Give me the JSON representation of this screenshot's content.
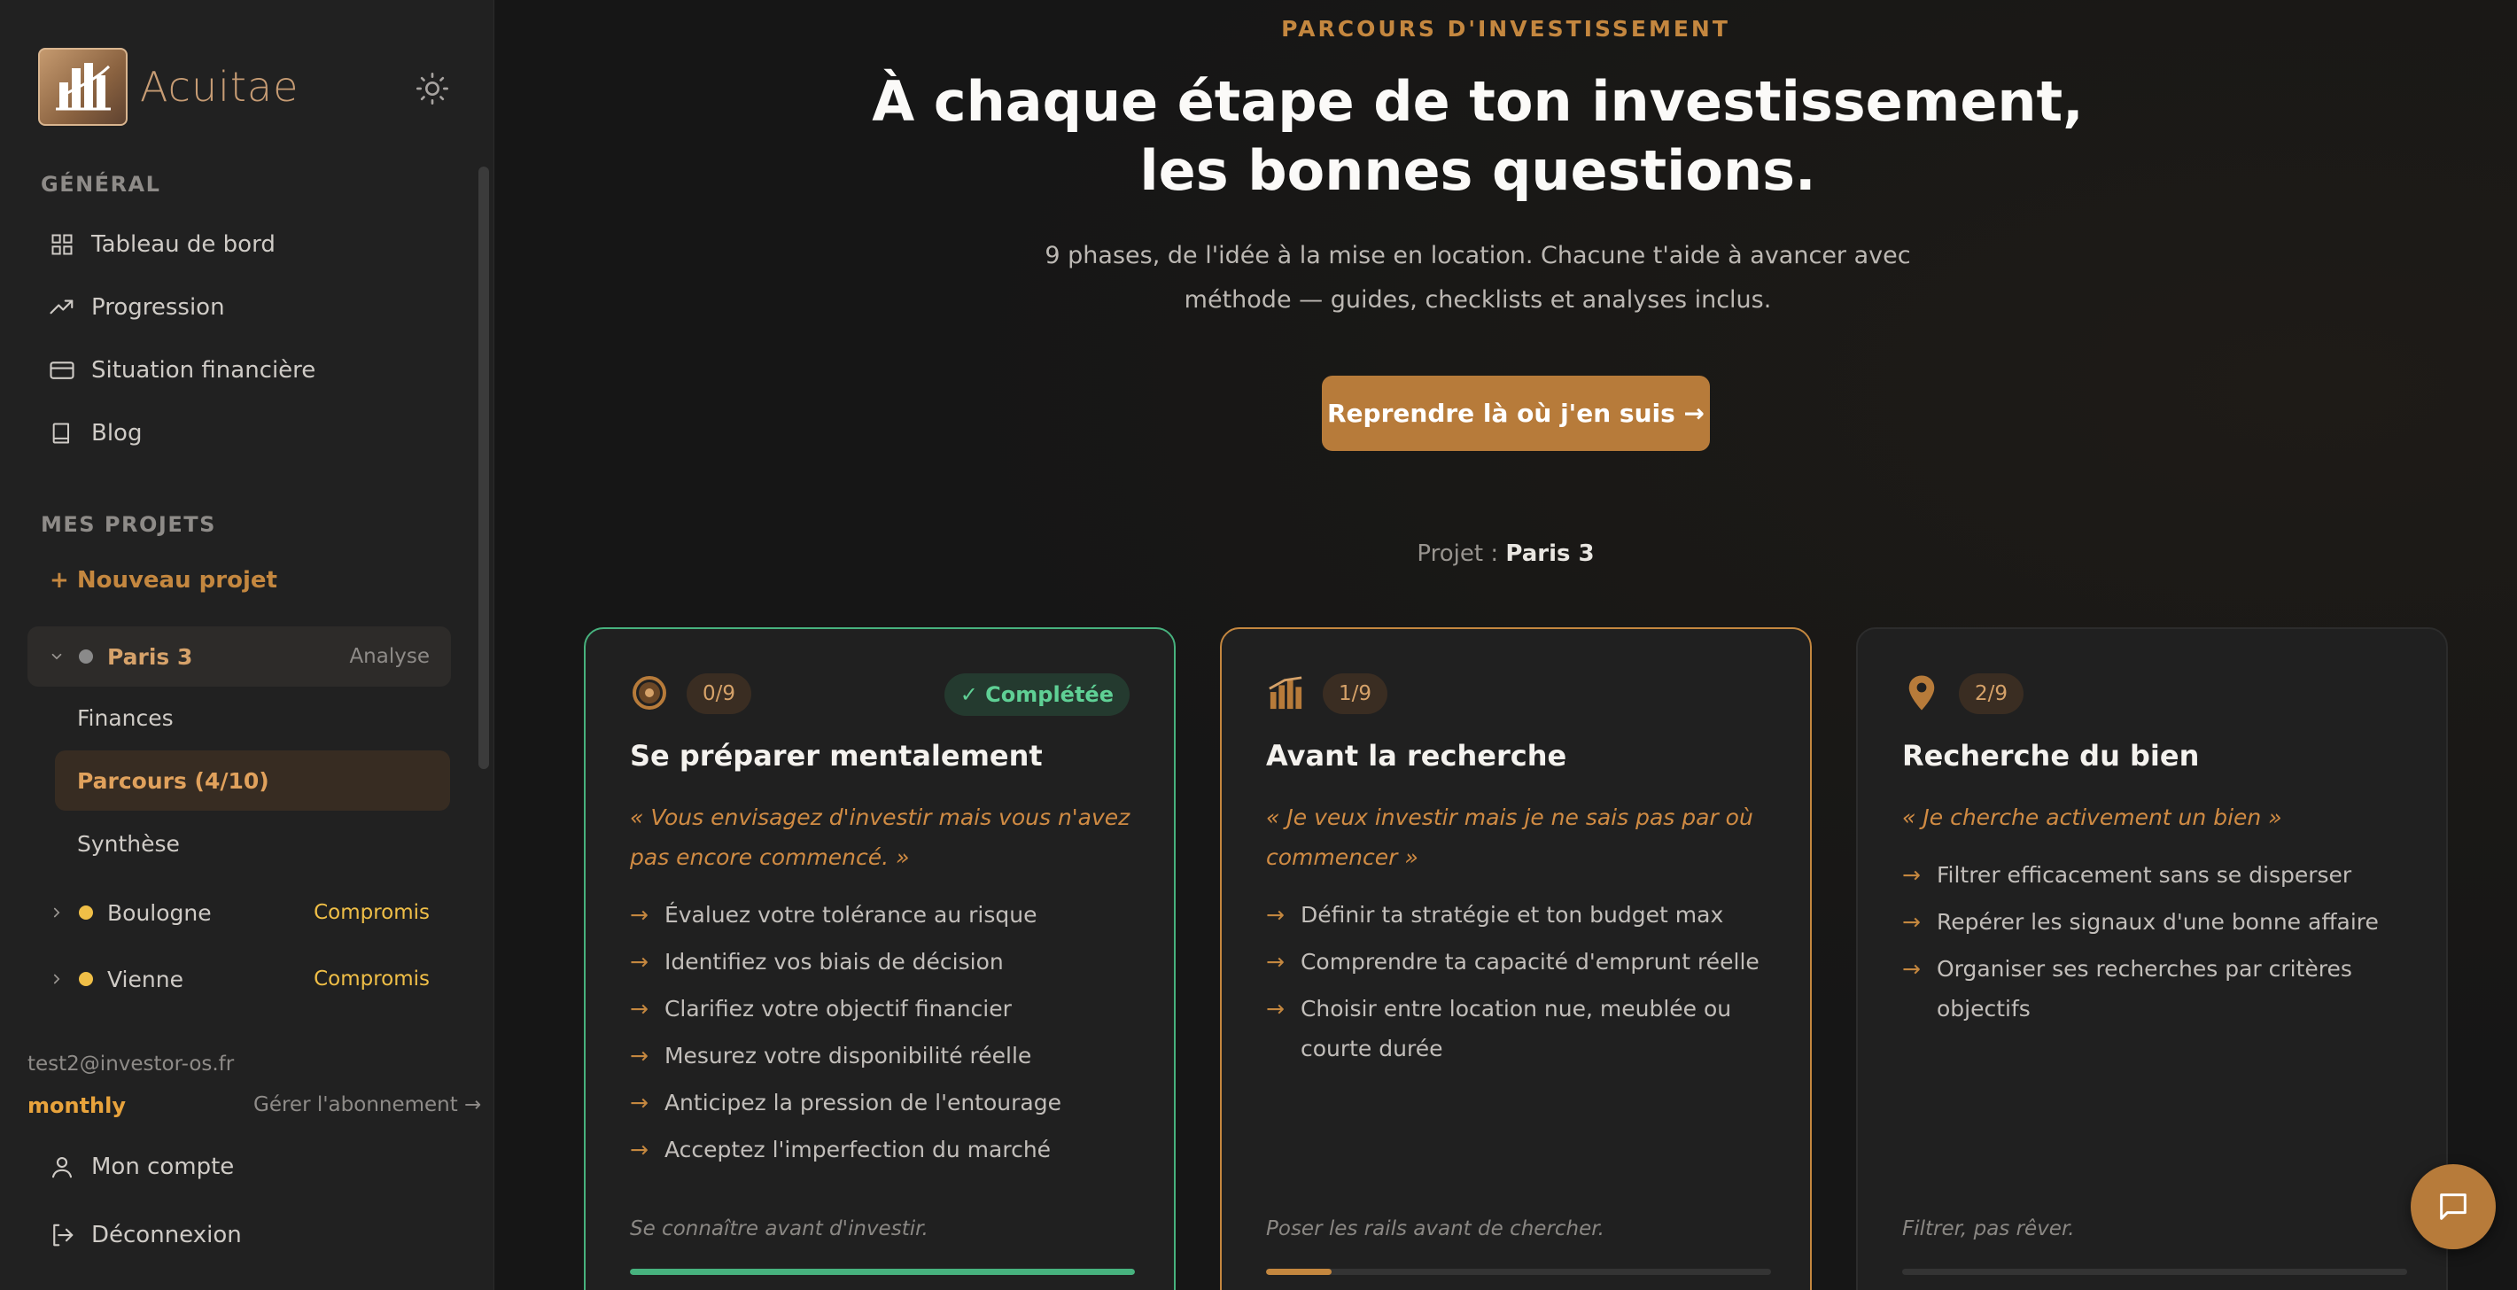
{
  "brand": {
    "name": "Acuitae"
  },
  "sidebar": {
    "general_label": "GÉNÉRAL",
    "nav": [
      {
        "label": "Tableau de bord",
        "icon": "grid-icon"
      },
      {
        "label": "Progression",
        "icon": "trending-up-icon"
      },
      {
        "label": "Situation financière",
        "icon": "credit-card-icon"
      },
      {
        "label": "Blog",
        "icon": "book-icon"
      }
    ],
    "projects_label": "MES PROJETS",
    "new_project": "+ Nouveau projet",
    "projects": [
      {
        "name": "Paris 3",
        "status": "Analyse",
        "expanded": true,
        "dot_color": "#8a8a8a"
      },
      {
        "name": "Boulogne",
        "status": "Compromis",
        "expanded": false,
        "dot_color": "#f0bf47"
      },
      {
        "name": "Vienne",
        "status": "Compromis",
        "expanded": false,
        "dot_color": "#f0bf47"
      }
    ],
    "sub_items": [
      "Finances",
      "Parcours (4/10)",
      "Synthèse"
    ],
    "email": "test2@investor-os.fr",
    "plan": "monthly",
    "manage": "Gérer l'abonnement →",
    "account": "Mon compte",
    "logout": "Déconnexion"
  },
  "hero": {
    "eyebrow": "PARCOURS D'INVESTISSEMENT",
    "headline": "À chaque étape de ton investissement, les bonnes questions.",
    "subtitle": "9 phases, de l'idée à la mise en location. Chacune t'aide à avancer avec méthode — guides, checklists et analyses inclus.",
    "cta": "Reprendre là où j'en suis →",
    "project_prefix": "Projet : ",
    "project_name": "Paris 3"
  },
  "cards": [
    {
      "phase": "0/9",
      "badge": "✓ Complétée",
      "title": "Se préparer mentalement",
      "quote": "« Vous envisagez d'investir mais vous n'avez pas encore commencé. »",
      "bullets": [
        "Évaluez votre tolérance au risque",
        "Identifiez vos biais de décision",
        "Clarifiez votre objectif financier",
        "Mesurez votre disponibilité réelle",
        "Anticipez la pression de l'entourage",
        "Acceptez l'imperfection du marché"
      ],
      "tagline": "Se connaître avant d'investir.",
      "progress": 1.0,
      "progress_color": "#47b27e",
      "icon": "target-icon"
    },
    {
      "phase": "1/9",
      "title": "Avant la recherche",
      "quote": "« Je veux investir mais je ne sais pas par où commencer »",
      "bullets": [
        "Définir ta stratégie et ton budget max",
        "Comprendre ta capacité d'emprunt réelle",
        "Choisir entre location nue, meublée ou courte durée"
      ],
      "tagline": "Poser les rails avant de chercher.",
      "progress": 0.13,
      "progress_color": "#c4873f",
      "icon": "bar-chart-icon"
    },
    {
      "phase": "2/9",
      "title": "Recherche du bien",
      "quote": "« Je cherche activement un bien »",
      "bullets": [
        "Filtrer efficacement sans se disperser",
        "Repérer les signaux d'une bonne affaire",
        "Organiser ses recherches par critères objectifs"
      ],
      "tagline": "Filtrer, pas rêver.",
      "progress": 0.0,
      "progress_color": "#c4873f",
      "icon": "map-pin-icon"
    }
  ],
  "colors": {
    "accent": "#c4873f",
    "success": "#47b27e",
    "warning": "#f0bf47"
  }
}
